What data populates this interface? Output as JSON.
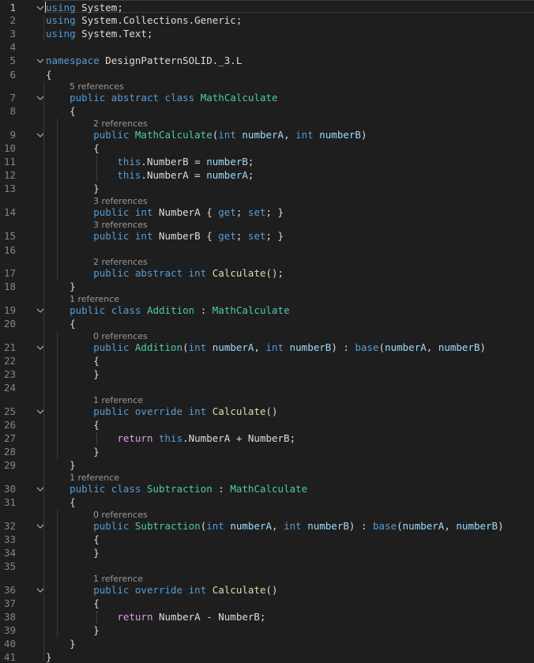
{
  "colors": {
    "background": "#1e1e1e",
    "plain": "#dcdcdc",
    "keyword": "#569cd6",
    "control": "#d8a0df",
    "type": "#4ec9b0",
    "method": "#dcdcaa",
    "parameter": "#9cdcfe",
    "line_number": "#858585",
    "codelens": "#999999"
  },
  "lines": [
    {
      "num": "1",
      "fold": true,
      "tokens": [
        {
          "t": "using",
          "c": "k"
        },
        {
          "t": " System;",
          "c": "p"
        }
      ]
    },
    {
      "num": "2",
      "tokens": [
        {
          "t": "using",
          "c": "k"
        },
        {
          "t": " System.Collections.Generic;",
          "c": "p"
        }
      ]
    },
    {
      "num": "3",
      "tokens": [
        {
          "t": "using",
          "c": "k"
        },
        {
          "t": " System.Text;",
          "c": "p"
        }
      ]
    },
    {
      "num": "4",
      "tokens": []
    },
    {
      "num": "5",
      "fold": true,
      "tokens": [
        {
          "t": "namespace",
          "c": "k"
        },
        {
          "t": " DesignPatternSOLID._3.L",
          "c": "p"
        }
      ]
    },
    {
      "num": "6",
      "tokens": [
        {
          "t": "{",
          "c": "p"
        }
      ]
    },
    {
      "num": "7",
      "lens": "5 references",
      "fold": true,
      "tokens": [
        {
          "t": "    "
        },
        {
          "t": "public",
          "c": "k"
        },
        {
          "t": " "
        },
        {
          "t": "abstract",
          "c": "k"
        },
        {
          "t": " "
        },
        {
          "t": "class",
          "c": "k"
        },
        {
          "t": " "
        },
        {
          "t": "MathCalculate",
          "c": "y"
        }
      ]
    },
    {
      "num": "8",
      "tokens": [
        {
          "t": "    {"
        }
      ]
    },
    {
      "num": "9",
      "lens": "2 references",
      "fold": true,
      "tokens": [
        {
          "t": "        "
        },
        {
          "t": "public",
          "c": "k"
        },
        {
          "t": " "
        },
        {
          "t": "MathCalculate",
          "c": "y"
        },
        {
          "t": "("
        },
        {
          "t": "int",
          "c": "k"
        },
        {
          "t": " "
        },
        {
          "t": "numberA",
          "c": "v"
        },
        {
          "t": ", "
        },
        {
          "t": "int",
          "c": "k"
        },
        {
          "t": " "
        },
        {
          "t": "numberB",
          "c": "v"
        },
        {
          "t": ")"
        }
      ]
    },
    {
      "num": "10",
      "tokens": [
        {
          "t": "        {"
        }
      ]
    },
    {
      "num": "11",
      "tokens": [
        {
          "t": "            "
        },
        {
          "t": "this",
          "c": "k"
        },
        {
          "t": ".NumberB = "
        },
        {
          "t": "numberB",
          "c": "v"
        },
        {
          "t": ";"
        }
      ]
    },
    {
      "num": "12",
      "tokens": [
        {
          "t": "            "
        },
        {
          "t": "this",
          "c": "k"
        },
        {
          "t": ".NumberA = "
        },
        {
          "t": "numberA",
          "c": "v"
        },
        {
          "t": ";"
        }
      ]
    },
    {
      "num": "13",
      "tokens": [
        {
          "t": "        }"
        }
      ]
    },
    {
      "num": "14",
      "lens": "3 references",
      "tokens": [
        {
          "t": "        "
        },
        {
          "t": "public",
          "c": "k"
        },
        {
          "t": " "
        },
        {
          "t": "int",
          "c": "k"
        },
        {
          "t": " NumberA { "
        },
        {
          "t": "get",
          "c": "k"
        },
        {
          "t": "; "
        },
        {
          "t": "set",
          "c": "k"
        },
        {
          "t": "; }"
        }
      ]
    },
    {
      "num": "15",
      "lens": "3 references",
      "tokens": [
        {
          "t": "        "
        },
        {
          "t": "public",
          "c": "k"
        },
        {
          "t": " "
        },
        {
          "t": "int",
          "c": "k"
        },
        {
          "t": " NumberB { "
        },
        {
          "t": "get",
          "c": "k"
        },
        {
          "t": "; "
        },
        {
          "t": "set",
          "c": "k"
        },
        {
          "t": "; }"
        }
      ]
    },
    {
      "num": "16",
      "tokens": []
    },
    {
      "num": "17",
      "lens": "2 references",
      "tokens": [
        {
          "t": "        "
        },
        {
          "t": "public",
          "c": "k"
        },
        {
          "t": " "
        },
        {
          "t": "abstract",
          "c": "k"
        },
        {
          "t": " "
        },
        {
          "t": "int",
          "c": "k"
        },
        {
          "t": " "
        },
        {
          "t": "Calculate",
          "c": "m"
        },
        {
          "t": "();"
        }
      ]
    },
    {
      "num": "18",
      "tokens": [
        {
          "t": "    }"
        }
      ]
    },
    {
      "num": "19",
      "lens": "1 reference",
      "fold": true,
      "tokens": [
        {
          "t": "    "
        },
        {
          "t": "public",
          "c": "k"
        },
        {
          "t": " "
        },
        {
          "t": "class",
          "c": "k"
        },
        {
          "t": " "
        },
        {
          "t": "Addition",
          "c": "y"
        },
        {
          "t": " : "
        },
        {
          "t": "MathCalculate",
          "c": "y"
        }
      ]
    },
    {
      "num": "20",
      "tokens": [
        {
          "t": "    {"
        }
      ]
    },
    {
      "num": "21",
      "lens": "0 references",
      "fold": true,
      "tokens": [
        {
          "t": "        "
        },
        {
          "t": "public",
          "c": "k"
        },
        {
          "t": " "
        },
        {
          "t": "Addition",
          "c": "y"
        },
        {
          "t": "("
        },
        {
          "t": "int",
          "c": "k"
        },
        {
          "t": " "
        },
        {
          "t": "numberA",
          "c": "v"
        },
        {
          "t": ", "
        },
        {
          "t": "int",
          "c": "k"
        },
        {
          "t": " "
        },
        {
          "t": "numberB",
          "c": "v"
        },
        {
          "t": ") : "
        },
        {
          "t": "base",
          "c": "k"
        },
        {
          "t": "("
        },
        {
          "t": "numberA",
          "c": "v"
        },
        {
          "t": ", "
        },
        {
          "t": "numberB",
          "c": "v"
        },
        {
          "t": ")"
        }
      ]
    },
    {
      "num": "22",
      "tokens": [
        {
          "t": "        {"
        }
      ]
    },
    {
      "num": "23",
      "tokens": [
        {
          "t": "        }"
        }
      ]
    },
    {
      "num": "24",
      "tokens": []
    },
    {
      "num": "25",
      "lens": "1 reference",
      "fold": true,
      "tokens": [
        {
          "t": "        "
        },
        {
          "t": "public",
          "c": "k"
        },
        {
          "t": " "
        },
        {
          "t": "override",
          "c": "k"
        },
        {
          "t": " "
        },
        {
          "t": "int",
          "c": "k"
        },
        {
          "t": " "
        },
        {
          "t": "Calculate",
          "c": "m"
        },
        {
          "t": "()"
        }
      ]
    },
    {
      "num": "26",
      "tokens": [
        {
          "t": "        {"
        }
      ]
    },
    {
      "num": "27",
      "tokens": [
        {
          "t": "            "
        },
        {
          "t": "return",
          "c": "r"
        },
        {
          "t": " "
        },
        {
          "t": "this",
          "c": "k"
        },
        {
          "t": ".NumberA + NumberB;"
        }
      ]
    },
    {
      "num": "28",
      "tokens": [
        {
          "t": "        }"
        }
      ]
    },
    {
      "num": "29",
      "tokens": [
        {
          "t": "    }"
        }
      ]
    },
    {
      "num": "30",
      "lens": "1 reference",
      "fold": true,
      "tokens": [
        {
          "t": "    "
        },
        {
          "t": "public",
          "c": "k"
        },
        {
          "t": " "
        },
        {
          "t": "class",
          "c": "k"
        },
        {
          "t": " "
        },
        {
          "t": "Subtraction",
          "c": "y"
        },
        {
          "t": " : "
        },
        {
          "t": "MathCalculate",
          "c": "y"
        }
      ]
    },
    {
      "num": "31",
      "tokens": [
        {
          "t": "    {"
        }
      ]
    },
    {
      "num": "32",
      "lens": "0 references",
      "fold": true,
      "tokens": [
        {
          "t": "        "
        },
        {
          "t": "public",
          "c": "k"
        },
        {
          "t": " "
        },
        {
          "t": "Subtraction",
          "c": "y"
        },
        {
          "t": "("
        },
        {
          "t": "int",
          "c": "k"
        },
        {
          "t": " "
        },
        {
          "t": "numberA",
          "c": "v"
        },
        {
          "t": ", "
        },
        {
          "t": "int",
          "c": "k"
        },
        {
          "t": " "
        },
        {
          "t": "numberB",
          "c": "v"
        },
        {
          "t": ") : "
        },
        {
          "t": "base",
          "c": "k"
        },
        {
          "t": "("
        },
        {
          "t": "numberA",
          "c": "v"
        },
        {
          "t": ", "
        },
        {
          "t": "numberB",
          "c": "v"
        },
        {
          "t": ")"
        }
      ]
    },
    {
      "num": "33",
      "tokens": [
        {
          "t": "        {"
        }
      ]
    },
    {
      "num": "34",
      "tokens": [
        {
          "t": "        }"
        }
      ]
    },
    {
      "num": "35",
      "tokens": []
    },
    {
      "num": "36",
      "lens": "1 reference",
      "fold": true,
      "tokens": [
        {
          "t": "        "
        },
        {
          "t": "public",
          "c": "k"
        },
        {
          "t": " "
        },
        {
          "t": "override",
          "c": "k"
        },
        {
          "t": " "
        },
        {
          "t": "int",
          "c": "k"
        },
        {
          "t": " "
        },
        {
          "t": "Calculate",
          "c": "m"
        },
        {
          "t": "()"
        }
      ]
    },
    {
      "num": "37",
      "tokens": [
        {
          "t": "        {"
        }
      ]
    },
    {
      "num": "38",
      "tokens": [
        {
          "t": "            "
        },
        {
          "t": "return",
          "c": "r"
        },
        {
          "t": " NumberA - NumberB;"
        }
      ]
    },
    {
      "num": "39",
      "tokens": [
        {
          "t": "        }"
        }
      ]
    },
    {
      "num": "40",
      "tokens": [
        {
          "t": "    }"
        }
      ]
    },
    {
      "num": "41",
      "tokens": [
        {
          "t": "}"
        }
      ]
    }
  ]
}
